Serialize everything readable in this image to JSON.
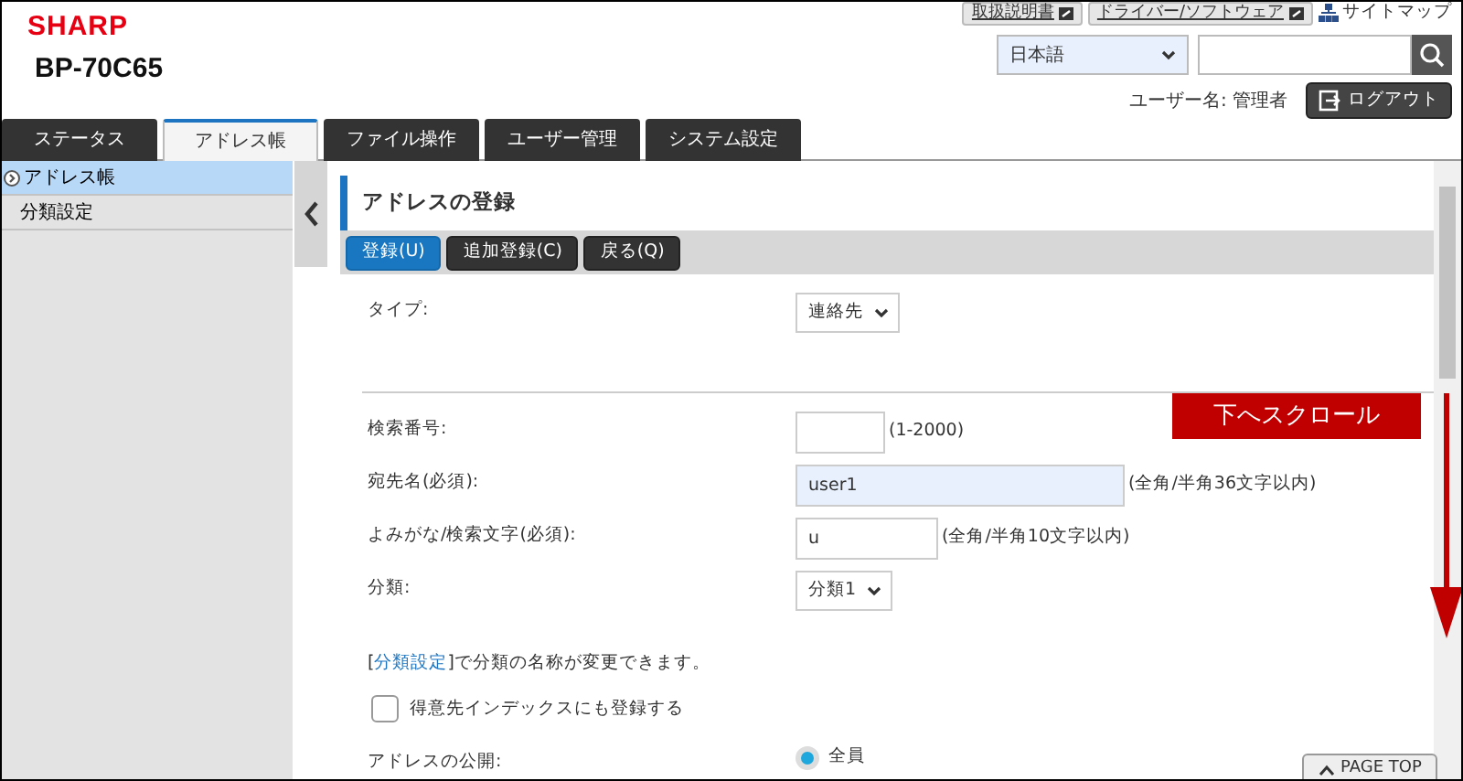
{
  "brand": {
    "logo": "SHARP",
    "model": "BP-70C65"
  },
  "top_links": [
    {
      "label": "取扱説明書",
      "kind": "external"
    },
    {
      "label": "ドライバー/ソフトウェア",
      "kind": "external"
    },
    {
      "label": "サイトマップ",
      "kind": "sitemap"
    }
  ],
  "language_select": {
    "value": "日本語"
  },
  "user": {
    "label": "ユーザー名: 管理者"
  },
  "logout": {
    "label": "ログアウト"
  },
  "tabs": [
    {
      "label": "ステータス",
      "selected": false
    },
    {
      "label": "アドレス帳",
      "selected": true
    },
    {
      "label": "ファイル操作",
      "selected": false
    },
    {
      "label": "ユーザー管理",
      "selected": false
    },
    {
      "label": "システム設定",
      "selected": false
    }
  ],
  "sidebar": {
    "items": [
      {
        "label": "アドレス帳",
        "selected": true
      },
      {
        "label": "分類設定",
        "selected": false
      }
    ]
  },
  "page_title": "アドレスの登録",
  "actions": [
    {
      "label": "登録(U)",
      "primary": true
    },
    {
      "label": "追加登録(C)",
      "primary": false
    },
    {
      "label": "戻る(Q)",
      "primary": false
    }
  ],
  "form": {
    "rows": [
      {
        "kind": "select",
        "label": "タイプ:",
        "value": "連絡先"
      },
      {
        "kind": "divider"
      },
      {
        "kind": "input",
        "label": "検索番号:",
        "hint": "(1-2000)",
        "short": true,
        "wide": false,
        "autofilled": false
      },
      {
        "kind": "input",
        "label": "宛先名(必須):",
        "value": "user1",
        "hint": "(全角/半角36文字以内)",
        "short": false,
        "wide": true,
        "autofilled": true
      },
      {
        "kind": "input",
        "label": "よみがな/検索文字(必須):",
        "value": "u",
        "hint": "(全角/半角10文字以内)",
        "short": false,
        "wide": false,
        "autofilled": false
      },
      {
        "kind": "select",
        "label": "分類:",
        "value": "分類1"
      },
      {
        "kind": "note",
        "before": "[",
        "link": "分類設定",
        "after": "]で分類の名称が変更できます。"
      },
      {
        "kind": "checkbox",
        "label": "得意先インデックスにも登録する",
        "checked": false
      },
      {
        "kind": "radio",
        "label": "アドレスの公開:",
        "options": [
          {
            "label": "全員",
            "selected": true
          }
        ]
      }
    ]
  },
  "annotation": {
    "text": "下へスクロール"
  },
  "page_top": {
    "label": "PAGE TOP"
  }
}
